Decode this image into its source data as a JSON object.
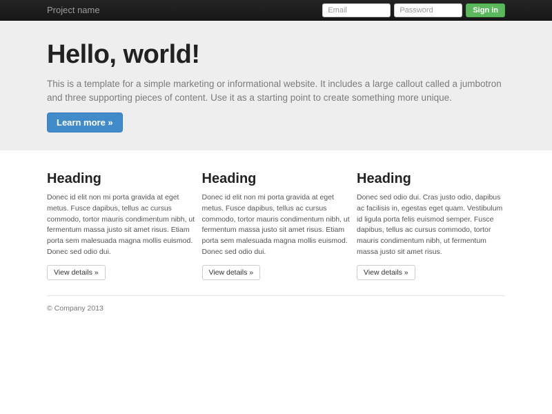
{
  "navbar": {
    "brand": "Project name",
    "form": {
      "email_placeholder": "Email",
      "password_placeholder": "Password",
      "signin_label": "Sign in"
    }
  },
  "jumbotron": {
    "title": "Hello, world!",
    "description": "This is a template for a simple marketing or informational website. It includes a large callout called a jumbotron and three supporting pieces of content. Use it as a starting point to create something more unique.",
    "cta_label": "Learn more »"
  },
  "columns": [
    {
      "heading": "Heading",
      "text": "Donec id elit non mi porta gravida at eget metus. Fusce dapibus, tellus ac cursus commodo, tortor mauris condimentum nibh, ut fermentum massa justo sit amet risus. Etiam porta sem malesuada magna mollis euismod. Donec sed odio dui.",
      "button_label": "View details »"
    },
    {
      "heading": "Heading",
      "text": "Donec id elit non mi porta gravida at eget metus. Fusce dapibus, tellus ac cursus commodo, tortor mauris condimentum nibh, ut fermentum massa justo sit amet risus. Etiam porta sem malesuada magna mollis euismod. Donec sed odio dui.",
      "button_label": "View details »"
    },
    {
      "heading": "Heading",
      "text": "Donec sed odio dui. Cras justo odio, dapibus ac facilisis in, egestas eget quam. Vestibulum id ligula porta felis euismod semper. Fusce dapibus, tellus ac cursus commodo, tortor mauris condimentum nibh, ut fermentum massa justo sit amet risus.",
      "button_label": "View details »"
    }
  ],
  "footer": {
    "copyright": "© Company 2013"
  },
  "colors": {
    "primary": "#428bca",
    "success": "#5cb85c",
    "navbar_bg": "#1b1b1b",
    "jumbotron_bg": "#eeeeee"
  }
}
